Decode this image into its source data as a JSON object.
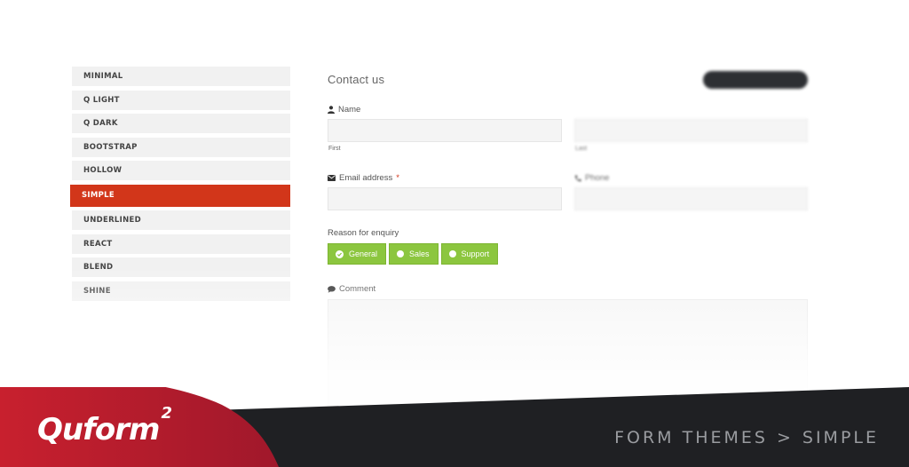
{
  "themes": {
    "items": [
      {
        "label": "MINIMAL"
      },
      {
        "label": "Q LIGHT"
      },
      {
        "label": "Q DARK"
      },
      {
        "label": "BOOTSTRAP"
      },
      {
        "label": "HOLLOW"
      },
      {
        "label": "SIMPLE"
      },
      {
        "label": "UNDERLINED"
      },
      {
        "label": "REACT"
      },
      {
        "label": "BLEND"
      },
      {
        "label": "SHINE"
      }
    ],
    "active": "SIMPLE",
    "active_color": "#d2361a"
  },
  "form": {
    "title": "Contact us",
    "name_label": "Name",
    "first_sublabel": "First",
    "last_sublabel": "Last",
    "email_label": "Email address",
    "email_required_mark": "*",
    "phone_label": "Phone",
    "reason_label": "Reason for enquiry",
    "reason_options": [
      {
        "label": "General",
        "selected": true
      },
      {
        "label": "Sales",
        "selected": false
      },
      {
        "label": "Support",
        "selected": false
      }
    ],
    "comment_label": "Comment",
    "choice_color": "#8cc63f"
  },
  "banner": {
    "logo_text": "Quform",
    "logo_sup": "2",
    "breadcrumb_section": "FORM THEMES",
    "breadcrumb_separator": ">",
    "breadcrumb_current": "SIMPLE",
    "dark_color": "#1f2023",
    "red_color": "#c8202e"
  }
}
